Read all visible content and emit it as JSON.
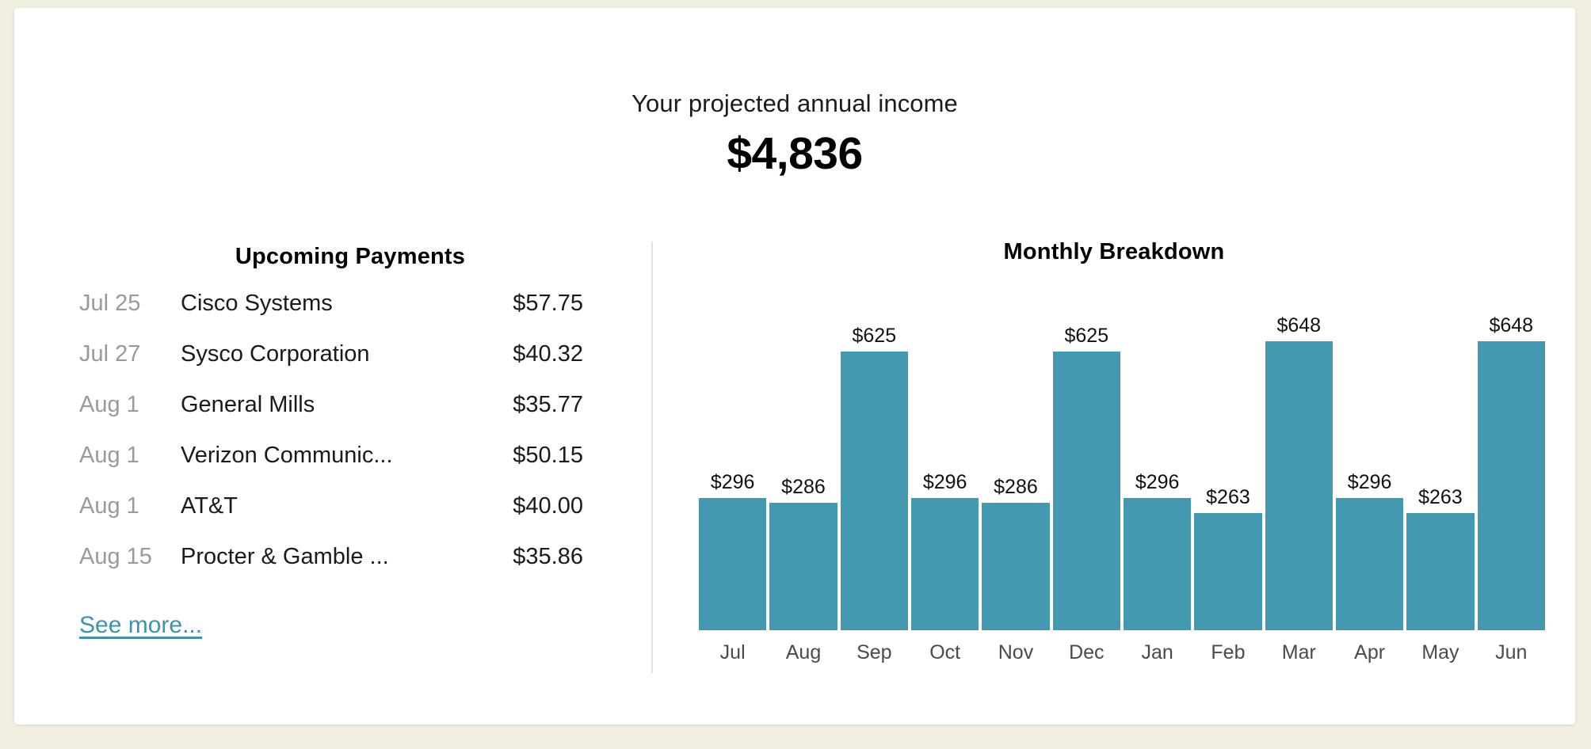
{
  "header": {
    "title": "Your projected annual income",
    "amount": "$4,836"
  },
  "payments": {
    "title": "Upcoming Payments",
    "rows": [
      {
        "date": "Jul 25",
        "name": "Cisco Systems",
        "amount": "$57.75"
      },
      {
        "date": "Jul 27",
        "name": "Sysco Corporation",
        "amount": "$40.32"
      },
      {
        "date": "Aug 1",
        "name": "General Mills",
        "amount": "$35.77"
      },
      {
        "date": "Aug 1",
        "name": "Verizon Communic...",
        "amount": "$50.15"
      },
      {
        "date": "Aug 1",
        "name": "AT&T",
        "amount": "$40.00"
      },
      {
        "date": "Aug 15",
        "name": "Procter & Gamble ...",
        "amount": "$35.86"
      }
    ],
    "see_more_label": "See more...",
    "link_color": "#3d93ab"
  },
  "chart_data": {
    "type": "bar",
    "title": "Monthly Breakdown",
    "xlabel": "",
    "ylabel": "",
    "categories": [
      "Jul",
      "Aug",
      "Sep",
      "Oct",
      "Nov",
      "Dec",
      "Jan",
      "Feb",
      "Mar",
      "Apr",
      "May",
      "Jun"
    ],
    "values": [
      296,
      286,
      625,
      296,
      286,
      625,
      296,
      263,
      648,
      296,
      263,
      648
    ],
    "data_labels": [
      "$296",
      "$286",
      "$625",
      "$296",
      "$286",
      "$625",
      "$296",
      "$263",
      "$648",
      "$296",
      "$263",
      "$648"
    ],
    "ylim": [
      0,
      720
    ],
    "grid": false,
    "legend": false,
    "bar_color": "#4299b0"
  },
  "theme": {
    "page_background": "#f2f0e0",
    "card_background": "#ffffff",
    "accent": "#4299b0",
    "muted_text": "#9a9a9a"
  }
}
